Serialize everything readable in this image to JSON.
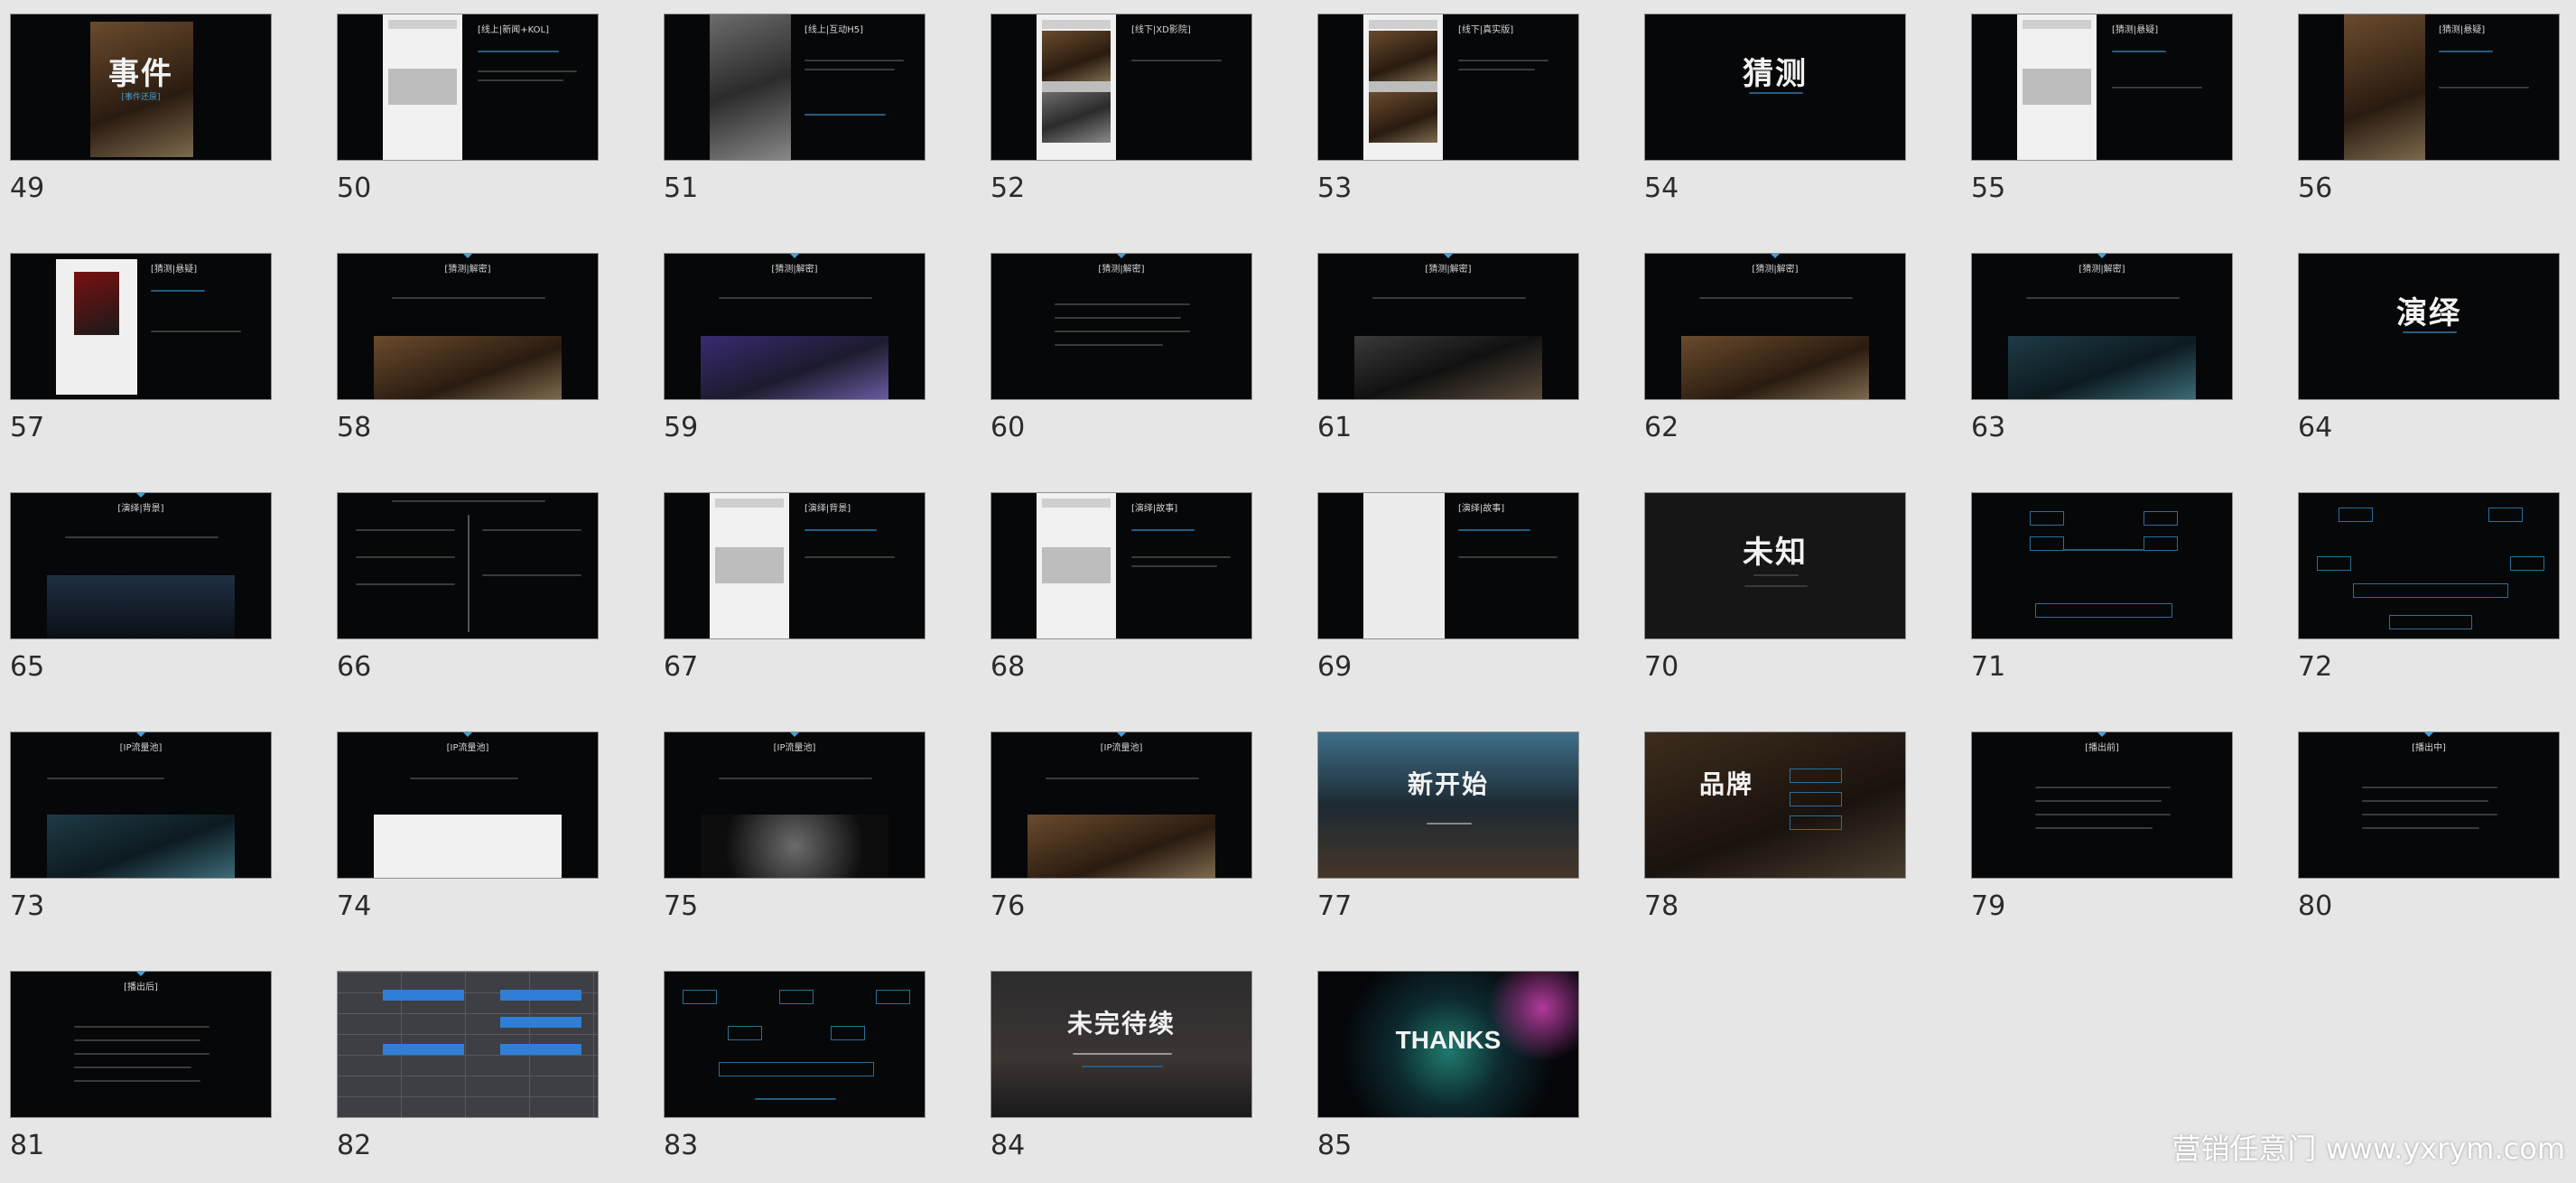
{
  "watermark": "营销任意门 www.yxrym.com",
  "colors": {
    "background": "#e6e6e6",
    "slide": "#060709",
    "accent": "#3fa2dc",
    "number": "#2b2b2b"
  },
  "slides": [
    {
      "number": "49",
      "title": "",
      "subtitle": "",
      "big": "事件",
      "big_subtitle": "[事件还原]"
    },
    {
      "number": "50",
      "title": "[线上|新闻+KOL]",
      "subtitle": "",
      "big": "",
      "big_subtitle": ""
    },
    {
      "number": "51",
      "title": "[线上|互动H5]",
      "subtitle": "",
      "big": "",
      "big_subtitle": ""
    },
    {
      "number": "52",
      "title": "[线下|XD影院]",
      "subtitle": "",
      "big": "",
      "big_subtitle": ""
    },
    {
      "number": "53",
      "title": "[线下|真实版]",
      "subtitle": "",
      "big": "",
      "big_subtitle": ""
    },
    {
      "number": "54",
      "title": "",
      "subtitle": "",
      "big": "猜测",
      "big_subtitle": ""
    },
    {
      "number": "55",
      "title": "[猜测|悬疑]",
      "subtitle": "",
      "big": "",
      "big_subtitle": ""
    },
    {
      "number": "56",
      "title": "[猜测|悬疑]",
      "subtitle": "",
      "big": "",
      "big_subtitle": ""
    },
    {
      "number": "57",
      "title": "[猜测|悬疑]",
      "subtitle": "",
      "big": "",
      "big_subtitle": ""
    },
    {
      "number": "58",
      "title": "[猜测|解密]",
      "subtitle": "",
      "big": "",
      "big_subtitle": ""
    },
    {
      "number": "59",
      "title": "[猜测|解密]",
      "subtitle": "",
      "big": "",
      "big_subtitle": ""
    },
    {
      "number": "60",
      "title": "[猜测|解密]",
      "subtitle": "",
      "big": "",
      "big_subtitle": ""
    },
    {
      "number": "61",
      "title": "[猜测|解密]",
      "subtitle": "",
      "big": "",
      "big_subtitle": ""
    },
    {
      "number": "62",
      "title": "[猜测|解密]",
      "subtitle": "",
      "big": "",
      "big_subtitle": ""
    },
    {
      "number": "63",
      "title": "[猜测|解密]",
      "subtitle": "",
      "big": "",
      "big_subtitle": ""
    },
    {
      "number": "64",
      "title": "",
      "subtitle": "",
      "big": "演绎",
      "big_subtitle": ""
    },
    {
      "number": "65",
      "title": "[演绎|背景]",
      "subtitle": "",
      "big": "",
      "big_subtitle": ""
    },
    {
      "number": "66",
      "title": "",
      "subtitle": "",
      "big": "",
      "big_subtitle": ""
    },
    {
      "number": "67",
      "title": "[演绎|背景]",
      "subtitle": "",
      "big": "",
      "big_subtitle": ""
    },
    {
      "number": "68",
      "title": "[演绎|故事]",
      "subtitle": "",
      "big": "",
      "big_subtitle": ""
    },
    {
      "number": "69",
      "title": "[演绎|故事]",
      "subtitle": "",
      "big": "",
      "big_subtitle": ""
    },
    {
      "number": "70",
      "title": "",
      "subtitle": "",
      "big": "未知",
      "big_subtitle": ""
    },
    {
      "number": "71",
      "title": "",
      "subtitle": "",
      "big": "",
      "big_subtitle": ""
    },
    {
      "number": "72",
      "title": "",
      "subtitle": "",
      "big": "",
      "big_subtitle": ""
    },
    {
      "number": "73",
      "title": "[IP流量池]",
      "subtitle": "",
      "big": "",
      "big_subtitle": ""
    },
    {
      "number": "74",
      "title": "[IP流量池]",
      "subtitle": "",
      "big": "",
      "big_subtitle": ""
    },
    {
      "number": "75",
      "title": "[IP流量池]",
      "subtitle": "",
      "big": "",
      "big_subtitle": ""
    },
    {
      "number": "76",
      "title": "[IP流量池]",
      "subtitle": "",
      "big": "",
      "big_subtitle": ""
    },
    {
      "number": "77",
      "title": "",
      "subtitle": "",
      "big": "新开始",
      "big_subtitle": ""
    },
    {
      "number": "78",
      "title": "",
      "subtitle": "",
      "big": "品牌",
      "big_subtitle": ""
    },
    {
      "number": "79",
      "title": "[播出前]",
      "subtitle": "",
      "big": "",
      "big_subtitle": ""
    },
    {
      "number": "80",
      "title": "[播出中]",
      "subtitle": "",
      "big": "",
      "big_subtitle": ""
    },
    {
      "number": "81",
      "title": "[播出后]",
      "subtitle": "",
      "big": "",
      "big_subtitle": ""
    },
    {
      "number": "82",
      "title": "",
      "subtitle": "",
      "big": "",
      "big_subtitle": ""
    },
    {
      "number": "83",
      "title": "",
      "subtitle": "",
      "big": "",
      "big_subtitle": ""
    },
    {
      "number": "84",
      "title": "",
      "subtitle": "",
      "big": "未完待续",
      "big_subtitle": ""
    },
    {
      "number": "85",
      "title": "",
      "subtitle": "",
      "big": "THANKS",
      "big_subtitle": ""
    }
  ]
}
